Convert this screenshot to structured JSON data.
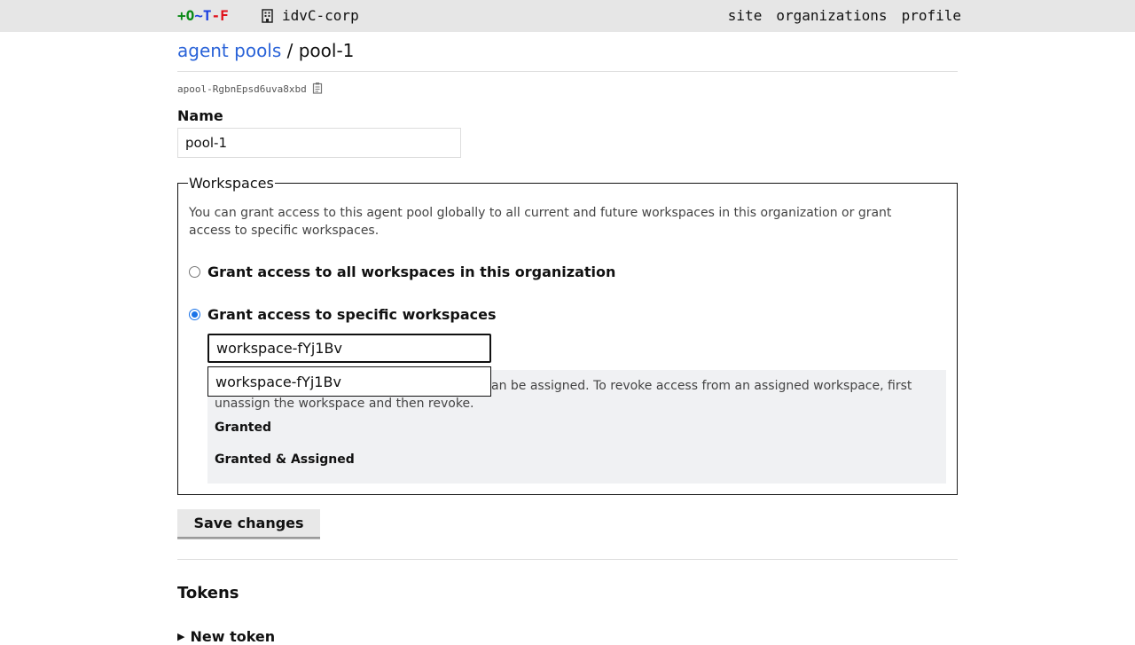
{
  "header": {
    "logo": {
      "part1": "+O",
      "part2": "~T",
      "part3": "-F"
    },
    "org_name": "idvC-corp",
    "nav": [
      "site",
      "organizations",
      "profile"
    ]
  },
  "breadcrumb": {
    "parent": "agent pools",
    "separator": " / ",
    "current": "pool-1"
  },
  "pool_id": "apool-RgbnEpsd6uva8xbd",
  "name": {
    "label": "Name",
    "value": "pool-1"
  },
  "workspaces": {
    "legend": "Workspaces",
    "description": "You can grant access to this agent pool globally to all current and future workspaces in this organization or grant access to specific workspaces.",
    "option_all": "Grant access to all workspaces in this organization",
    "option_specific": "Grant access to specific workspaces",
    "selected_option": "specific",
    "search_value": "workspace-fYj1Bv",
    "dropdown_option": "workspace-fYj1Bv",
    "info_text_visible": "an be assigned. To revoke access from an assigned workspace, first unassign the workspace and then revoke.",
    "granted_label": "Granted",
    "granted_assigned_label": "Granted & Assigned"
  },
  "save_button": "Save changes",
  "tokens": {
    "heading": "Tokens",
    "new_token": "New token"
  },
  "colors": {
    "link": "#2a63d8",
    "radio": "#1a73e8",
    "panel": "#f0f1f3",
    "topbar": "#e6e6e6"
  }
}
